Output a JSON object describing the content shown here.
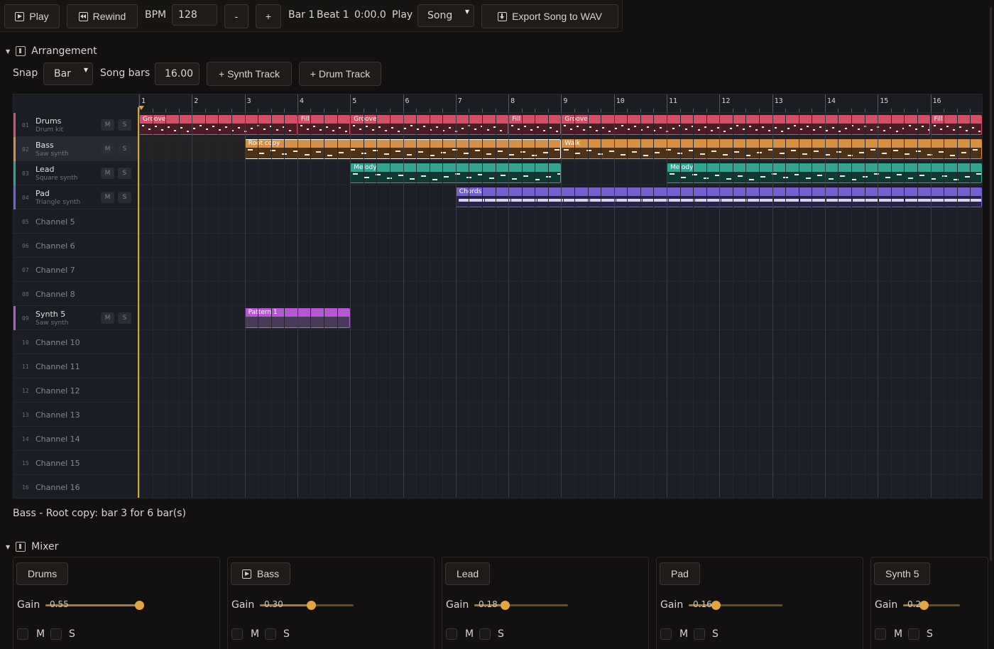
{
  "transport": {
    "play_label": "Play",
    "rewind_label": "Rewind",
    "bpm_label": "BPM",
    "bpm_value": "128",
    "minus_label": "-",
    "plus_label": "+",
    "bar_text": "Bar 1",
    "beat_text": "Beat 1",
    "time_text": "0:00.0",
    "play_mode_label": "Play",
    "play_mode_value": "Song",
    "export_label": "Export Song to WAV"
  },
  "arrangement": {
    "title": "Arrangement",
    "snap_label": "Snap",
    "snap_value": "Bar",
    "song_bars_label": "Song bars",
    "song_bars_value": "16.00",
    "add_synth_label": "+ Synth Track",
    "add_drum_label": "+ Drum Track",
    "bar_count": 16,
    "tracks": [
      {
        "num": "01",
        "name": "Drums",
        "sub": "Drum kit",
        "color": "#d24f67",
        "active": true,
        "clips": [
          {
            "label": "Groove",
            "start": 1,
            "len": 3
          },
          {
            "label": "Fill",
            "start": 4,
            "len": 1
          },
          {
            "label": "Groove",
            "start": 5,
            "len": 3
          },
          {
            "label": "Fill",
            "start": 8,
            "len": 1
          },
          {
            "label": "Groove",
            "start": 9,
            "len": 7
          },
          {
            "label": "Fill",
            "start": 16,
            "len": 1
          }
        ]
      },
      {
        "num": "02",
        "name": "Bass",
        "sub": "Saw synth",
        "color": "#d78f44",
        "active": true,
        "selected": true,
        "clips": [
          {
            "label": "Root copy",
            "start": 3,
            "len": 6,
            "selected": true
          },
          {
            "label": "Walk",
            "start": 9,
            "len": 8
          }
        ]
      },
      {
        "num": "03",
        "name": "Lead",
        "sub": "Square synth",
        "color": "#31a58f",
        "active": true,
        "clips": [
          {
            "label": "Melody",
            "start": 5,
            "len": 4
          },
          {
            "label": "Melody",
            "start": 11,
            "len": 6
          }
        ]
      },
      {
        "num": "04",
        "name": "Pad",
        "sub": "Triangle synth",
        "color": "#7460d0",
        "active": true,
        "clips": [
          {
            "label": "Chords",
            "start": 7,
            "len": 10
          }
        ]
      },
      {
        "num": "05",
        "name": "Channel 5",
        "sub": "",
        "color": "",
        "active": false,
        "clips": []
      },
      {
        "num": "06",
        "name": "Channel 6",
        "sub": "",
        "color": "",
        "active": false,
        "clips": []
      },
      {
        "num": "07",
        "name": "Channel 7",
        "sub": "",
        "color": "",
        "active": false,
        "clips": []
      },
      {
        "num": "08",
        "name": "Channel 8",
        "sub": "",
        "color": "",
        "active": false,
        "clips": []
      },
      {
        "num": "09",
        "name": "Synth 5",
        "sub": "Saw synth",
        "color": "#b35ad0",
        "active": true,
        "clips": [
          {
            "label": "Pattern 1",
            "start": 3,
            "len": 2,
            "empty": true
          }
        ]
      },
      {
        "num": "10",
        "name": "Channel 10",
        "sub": "",
        "color": "",
        "active": false,
        "clips": []
      },
      {
        "num": "11",
        "name": "Channel 11",
        "sub": "",
        "color": "",
        "active": false,
        "clips": []
      },
      {
        "num": "12",
        "name": "Channel 12",
        "sub": "",
        "color": "",
        "active": false,
        "clips": []
      },
      {
        "num": "13",
        "name": "Channel 13",
        "sub": "",
        "color": "",
        "active": false,
        "clips": []
      },
      {
        "num": "14",
        "name": "Channel 14",
        "sub": "",
        "color": "",
        "active": false,
        "clips": []
      },
      {
        "num": "15",
        "name": "Channel 15",
        "sub": "",
        "color": "",
        "active": false,
        "clips": []
      },
      {
        "num": "16",
        "name": "Channel 16",
        "sub": "",
        "color": "",
        "active": false,
        "clips": []
      }
    ],
    "mute_label": "M",
    "solo_label": "S"
  },
  "status": {
    "selection_text": "Bass - Root copy: bar 3 for 6 bar(s)"
  },
  "mixer": {
    "title": "Mixer",
    "gain_label": "Gain",
    "mute_label": "M",
    "solo_label": "S",
    "channels": [
      {
        "name": "Drums",
        "gain": 0.55,
        "gain_text": "0.55",
        "playing": false
      },
      {
        "name": "Bass",
        "gain": 0.3,
        "gain_text": "0.30",
        "playing": true
      },
      {
        "name": "Lead",
        "gain": 0.18,
        "gain_text": "0.18",
        "playing": false
      },
      {
        "name": "Pad",
        "gain": 0.16,
        "gain_text": "0.16",
        "playing": false
      },
      {
        "name": "Synth 5",
        "gain": 0.2,
        "gain_text": "0.2",
        "playing": false
      }
    ]
  },
  "colors": {
    "accent": "#e2a640",
    "playhead": "#d9a634"
  }
}
